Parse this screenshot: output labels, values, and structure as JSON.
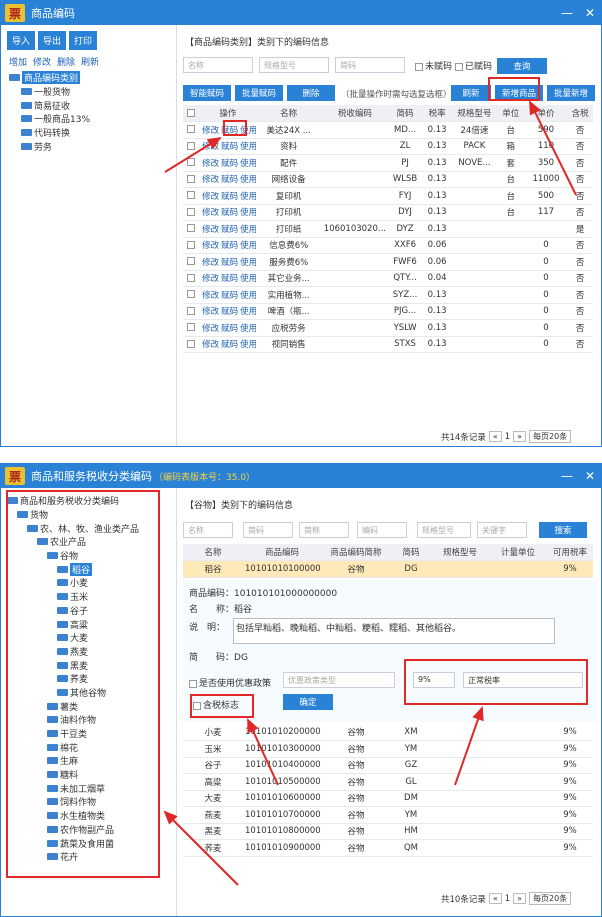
{
  "win1": {
    "title": "商品编码",
    "buttons": [
      "导入",
      "导出",
      "打印"
    ],
    "links": [
      "增加",
      "修改",
      "删除",
      "刷新"
    ],
    "tree": [
      {
        "label": "商品编码类别",
        "level": 0,
        "selected": true
      },
      {
        "label": "一般货物",
        "level": 1
      },
      {
        "label": "简易征收",
        "level": 1
      },
      {
        "label": "一般商品13%",
        "level": 1
      },
      {
        "label": "代码转换",
        "level": 1
      },
      {
        "label": "劳务",
        "level": 1
      }
    ],
    "crumb": "【商品编码类别】类别下的编码信息",
    "filters": {
      "name": "名称",
      "model": "规格型号",
      "short": "简码",
      "uncoded": "未赋码",
      "coded": "已赋码",
      "query": "查询"
    },
    "actions": {
      "batch_code": "智能赋码",
      "batch_code2": "批量赋码",
      "delete": "删除",
      "note": "（批量操作时需勾选复选框）",
      "refresh": "刷新",
      "add": "新增商品",
      "batch_add": "批量新增"
    },
    "headers": [
      "操作",
      "名称",
      "税收编码",
      "简码",
      "税率",
      "规格型号",
      "单位",
      "单价",
      "含税"
    ],
    "ops": [
      "修改",
      "赋码",
      "使用"
    ],
    "rows": [
      [
        "美达24X ...",
        "",
        "MD...",
        "0.13",
        "24倍速",
        "台",
        "590",
        "否"
      ],
      [
        "资料",
        "",
        "ZL",
        "0.13",
        "PACK",
        "箱",
        "110",
        "否"
      ],
      [
        "配件",
        "",
        "PJ",
        "0.13",
        "NOVE...",
        "套",
        "350",
        "否"
      ],
      [
        "网络设备",
        "",
        "WLSB",
        "0.13",
        "",
        "台",
        "11000",
        "否"
      ],
      [
        "复印机",
        "",
        "FYJ",
        "0.13",
        "",
        "台",
        "500",
        "否"
      ],
      [
        "打印机",
        "",
        "DYJ",
        "0.13",
        "",
        "台",
        "117",
        "否"
      ],
      [
        "打印纸",
        "1060103020...",
        "DYZ",
        "0.13",
        "",
        "",
        "",
        "是"
      ],
      [
        "信息费6%",
        "",
        "XXF6",
        "0.06",
        "",
        "",
        "0",
        "否"
      ],
      [
        "服务费6%",
        "",
        "FWF6",
        "0.06",
        "",
        "",
        "0",
        "否"
      ],
      [
        "其它业务...",
        "",
        "QTY...",
        "0.04",
        "",
        "",
        "0",
        "否"
      ],
      [
        "实用植物...",
        "",
        "SYZ...",
        "0.13",
        "",
        "",
        "0",
        "否"
      ],
      [
        "啤酒（瓶...",
        "",
        "PJG...",
        "0.13",
        "",
        "",
        "0",
        "否"
      ],
      [
        "应税劳务",
        "",
        "YSLW",
        "0.13",
        "",
        "",
        "0",
        "否"
      ],
      [
        "视同销售",
        "",
        "STXS",
        "0.13",
        "",
        "",
        "0",
        "否"
      ]
    ],
    "pager": {
      "total": "共14条记录",
      "page": "1",
      "per": "每页20条"
    }
  },
  "win2": {
    "title": "商品和服务税收分类编码",
    "badge": "（编码表版本号：35.0）",
    "tree": [
      {
        "label": "商品和服务税收分类编码",
        "level": 0
      },
      {
        "label": "货物",
        "level": 1
      },
      {
        "label": "农、林、牧、渔业类产品",
        "level": 2
      },
      {
        "label": "农业产品",
        "level": 3
      },
      {
        "label": "谷物",
        "level": 4
      },
      {
        "label": "稻谷",
        "level": 5,
        "selected": true
      },
      {
        "label": "小麦",
        "level": 5
      },
      {
        "label": "玉米",
        "level": 5
      },
      {
        "label": "谷子",
        "level": 5
      },
      {
        "label": "高粱",
        "level": 5
      },
      {
        "label": "大麦",
        "level": 5
      },
      {
        "label": "燕麦",
        "level": 5
      },
      {
        "label": "黑麦",
        "level": 5
      },
      {
        "label": "荞麦",
        "level": 5
      },
      {
        "label": "其他谷物",
        "level": 5
      },
      {
        "label": "薯类",
        "level": 4
      },
      {
        "label": "油料作物",
        "level": 4
      },
      {
        "label": "干豆类",
        "level": 4
      },
      {
        "label": "棉花",
        "level": 4
      },
      {
        "label": "生麻",
        "level": 4
      },
      {
        "label": "糖料",
        "level": 4
      },
      {
        "label": "未加工烟草",
        "level": 4
      },
      {
        "label": "饲料作物",
        "level": 4
      },
      {
        "label": "水生植物类",
        "level": 4
      },
      {
        "label": "农作物副产品",
        "level": 4
      },
      {
        "label": "蔬菜及食用菌",
        "level": 4
      },
      {
        "label": "花卉",
        "level": 4
      }
    ],
    "crumb": "【谷物】类别下的编码信息",
    "filters": [
      "名称",
      "简码",
      "简称",
      "编码",
      "规格型号",
      "关键字"
    ],
    "search": "搜索",
    "headers": [
      "名称",
      "商品编码",
      "商品编码简称",
      "简码",
      "规格型号",
      "计量单位",
      "可用税率"
    ],
    "first": [
      "稻谷",
      "10101010100000...",
      "谷物",
      "DG",
      "",
      "",
      "9%"
    ],
    "detail": {
      "code": "商品编码：101010101000000000",
      "name_label": "名　　称：",
      "name": "稻谷",
      "desc_label": "说　明：",
      "desc": "包括早籼稻、晚籼稻、中籼稻、粳稻、糯稻、其他稻谷。",
      "jm_label": "简　　码：",
      "jm": "DG",
      "pref": "是否使用优惠政策",
      "pref_type": "优惠政策类型",
      "rate": "9%",
      "rate_type": "正常税率",
      "tax_flag": "含税标志",
      "confirm": "确定"
    },
    "rows": [
      [
        "小麦",
        "10101010200000...",
        "谷物",
        "XM",
        "9%"
      ],
      [
        "玉米",
        "10101010300000...",
        "谷物",
        "YM",
        "9%"
      ],
      [
        "谷子",
        "10101010400000...",
        "谷物",
        "GZ",
        "9%"
      ],
      [
        "高粱",
        "10101010500000...",
        "谷物",
        "GL",
        "9%"
      ],
      [
        "大麦",
        "10101010600000...",
        "谷物",
        "DM",
        "9%"
      ],
      [
        "燕麦",
        "10101010700000...",
        "谷物",
        "YM",
        "9%"
      ],
      [
        "黑麦",
        "10101010800000...",
        "谷物",
        "HM",
        "9%"
      ],
      [
        "荞麦",
        "10101010900000...",
        "谷物",
        "QM",
        "9%"
      ]
    ],
    "pager": {
      "total": "共10条记录",
      "page": "1",
      "per": "每页20条"
    }
  }
}
